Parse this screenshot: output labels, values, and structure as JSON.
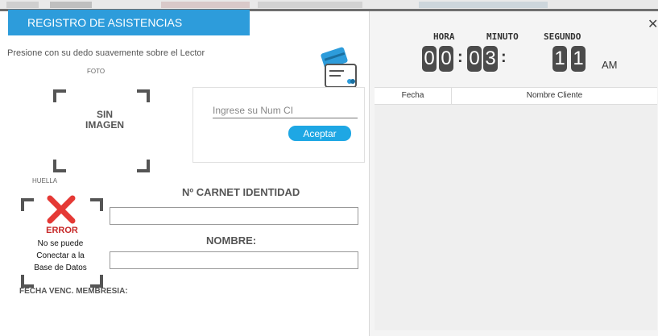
{
  "header": {
    "title": "REGISTRO DE ASISTENCIAS"
  },
  "instructions": "Presione con su dedo suavemente sobre el Lector",
  "photo": {
    "label": "FOTO",
    "no_image_line1": "SIN",
    "no_image_line2": "IMAGEN"
  },
  "ci_form": {
    "placeholder": "Ingrese su Num CI",
    "value": "",
    "accept_label": "Aceptar"
  },
  "fingerprint": {
    "label": "HUELLA",
    "error_title": "ERROR",
    "error_line1": "No se puede",
    "error_line2": "Conectar a la",
    "error_line3": "Base de Datos"
  },
  "fields": {
    "carnet_label": "Nº CARNET IDENTIDAD",
    "carnet_value": "",
    "nombre_label": "NOMBRE:",
    "nombre_value": "",
    "fecha_venc_label": "FECHA VENC. MEMBRESIA:"
  },
  "clock": {
    "hora_label": "HORA",
    "minuto_label": "MINUTO",
    "segundo_label": "SEGUNDO",
    "h1": "0",
    "h2": "0",
    "m1": "0",
    "m2": "3",
    "s1": "1",
    "s2": "1",
    "ampm": "AM"
  },
  "table": {
    "columns": [
      "Fecha",
      "Nombre Cliente"
    ],
    "rows": []
  },
  "colors": {
    "accent": "#2d9cdb",
    "button": "#1ea7e4",
    "error": "#c62828",
    "digit_bg": "#4b4b4b"
  },
  "icons": {
    "close": "close-icon",
    "card": "id-card-icon",
    "error": "error-x-icon"
  }
}
